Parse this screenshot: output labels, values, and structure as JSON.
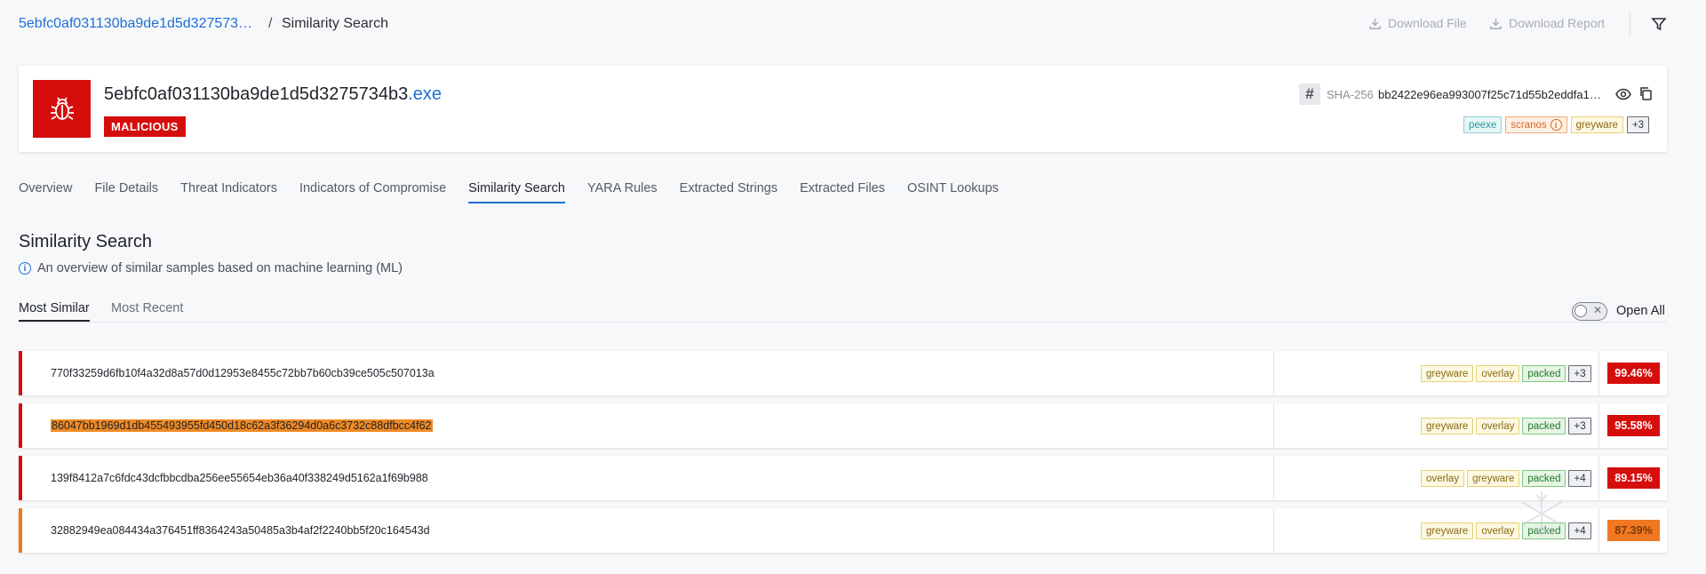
{
  "breadcrumb": {
    "link": "5ebfc0af031130ba9de1d5d327573…",
    "separator": "/",
    "current": "Similarity Search"
  },
  "toolbar": {
    "download_file": "Download File",
    "download_report": "Download Report",
    "filter_icon": "filter-icon"
  },
  "file": {
    "name_base": "5ebfc0af031130ba9de1d5d3275734b3",
    "name_ext": ".exe",
    "verdict": "MALICIOUS",
    "hash_symbol": "#",
    "sha_label": "SHA-256",
    "sha_value": "bb2422e96ea993007f25c71d55b2eddfa1…",
    "tags": [
      "peexe",
      "scranos",
      "greyware",
      "+3"
    ]
  },
  "tabs": [
    "Overview",
    "File Details",
    "Threat Indicators",
    "Indicators of Compromise",
    "Similarity Search",
    "YARA Rules",
    "Extracted Strings",
    "Extracted Files",
    "OSINT Lookups"
  ],
  "section": {
    "title": "Similarity Search",
    "subtitle": "An overview of similar samples based on machine learning (ML)"
  },
  "subtabs": {
    "most_similar": "Most Similar",
    "most_recent": "Most Recent",
    "toggle_label": "Open All"
  },
  "results": [
    {
      "hash": "770f33259d6fb10f4a32d8a57d0d12953e8455c72bb7b60cb39ce505c507013a",
      "tags": [
        "greyware",
        "overlay",
        "packed",
        "+3"
      ],
      "score": "99.46%"
    },
    {
      "hash": "86047bb1969d1db455493955fd450d18c62a3f36294d0a6c3732c88dfbcc4f62",
      "tags": [
        "greyware",
        "overlay",
        "packed",
        "+3"
      ],
      "score": "95.58%"
    },
    {
      "hash": "139f8412a7c6fdc43dcfbbcdba256ee55654eb36a40f338249d5162a1f69b988",
      "tags": [
        "overlay",
        "greyware",
        "packed",
        "+4"
      ],
      "score": "89.15%"
    },
    {
      "hash": "32882949ea084434a376451ff8364243a50485a3b4af2f2240bb5f20c164543d",
      "tags": [
        "greyware",
        "overlay",
        "packed",
        "+4"
      ],
      "score": "87.39%"
    }
  ],
  "colors": {
    "accent": "#1f6fd6",
    "malicious": "#d60d0d",
    "suspicious": "#f07820"
  }
}
